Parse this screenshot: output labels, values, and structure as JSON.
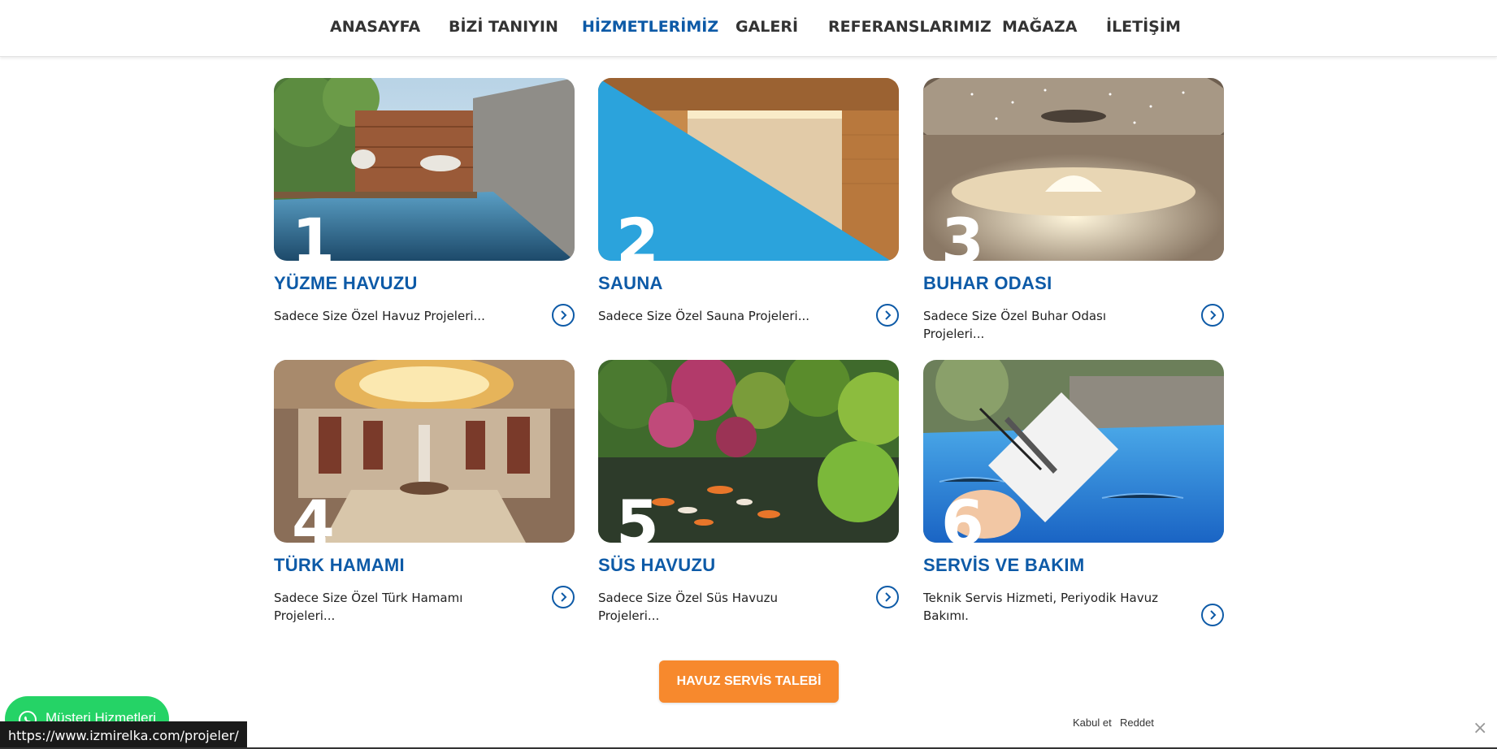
{
  "nav": {
    "items": [
      {
        "label": "ANASAYFA"
      },
      {
        "label": "BİZİ TANIYIN"
      },
      {
        "label": "HİZMETLERİMİZ",
        "active": true
      },
      {
        "label": "GALERİ"
      },
      {
        "label": "REFERANSLARIMIZ"
      },
      {
        "label": "MAĞAZA"
      },
      {
        "label": "İLETİŞİM"
      }
    ]
  },
  "services": [
    {
      "number": "1",
      "title": "YÜZME HAVUZU",
      "desc": "Sadece Size Özel Havuz Projeleri..."
    },
    {
      "number": "2",
      "title": "SAUNA",
      "desc": "Sadece Size Özel Sauna Projeleri..."
    },
    {
      "number": "3",
      "title": "BUHAR ODASI",
      "desc": "Sadece Size Özel Buhar Odası Projeleri..."
    },
    {
      "number": "4",
      "title": "TÜRK HAMAMI",
      "desc": "Sadece Size Özel Türk Hamamı Projeleri..."
    },
    {
      "number": "5",
      "title": "SÜS HAVUZU",
      "desc": "Sadece Size Özel Süs Havuzu Projeleri..."
    },
    {
      "number": "6",
      "title": "SERVİS VE BAKIM",
      "desc": "Teknik Servis Hizmeti, Periyodik Havuz Bakımı."
    }
  ],
  "cta": {
    "label": "HAVUZ SERVİS TALEBİ"
  },
  "whatsapp": {
    "label": "Müşteri Hizmetleri"
  },
  "status_url": "https://www.izmirelka.com/projeler/",
  "cookie": {
    "accept": "Kabul et",
    "reject": "Reddet"
  },
  "colors": {
    "accent": "#0d5aa7",
    "cta": "#f7892d",
    "whatsapp": "#25d366"
  }
}
